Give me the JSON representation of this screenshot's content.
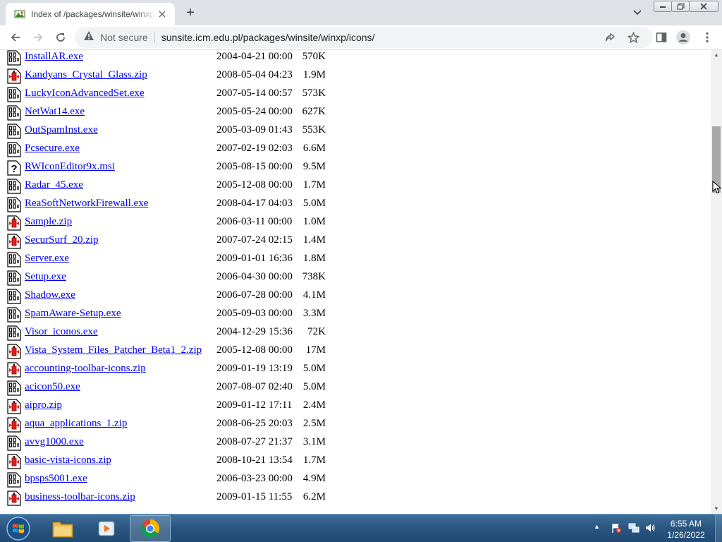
{
  "browser": {
    "tab_title": "Index of /packages/winsite/winxp/icons",
    "new_tab_label": "+",
    "security_label": "Not secure",
    "url": "sunsite.icm.edu.pl/packages/winsite/winxp/icons/"
  },
  "listing": [
    {
      "icon": "binary",
      "name": "InstallAR.exe",
      "date": "2004-04-21 00:00",
      "size": "570K"
    },
    {
      "icon": "archive",
      "name": "Kandyans_Crystal_Glass.zip",
      "date": "2008-05-04 04:23",
      "size": "1.9M"
    },
    {
      "icon": "binary",
      "name": "LuckyIconAdvancedSet.exe",
      "date": "2007-05-14 00:57",
      "size": "573K"
    },
    {
      "icon": "binary",
      "name": "NetWat14.exe",
      "date": "2005-05-24 00:00",
      "size": "627K"
    },
    {
      "icon": "binary",
      "name": "OutSpamInst.exe",
      "date": "2005-03-09 01:43",
      "size": "553K"
    },
    {
      "icon": "binary",
      "name": "Pcsecure.exe",
      "date": "2007-02-19 02:03",
      "size": "6.6M"
    },
    {
      "icon": "unknown",
      "name": "RWIconEditor9x.msi",
      "date": "2005-08-15 00:00",
      "size": "9.5M"
    },
    {
      "icon": "binary",
      "name": "Radar_45.exe",
      "date": "2005-12-08 00:00",
      "size": "1.7M"
    },
    {
      "icon": "binary",
      "name": "ReaSoftNetworkFirewall.exe",
      "date": "2008-04-17 04:03",
      "size": "5.0M"
    },
    {
      "icon": "archive",
      "name": "Sample.zip",
      "date": "2006-03-11 00:00",
      "size": "1.0M"
    },
    {
      "icon": "archive",
      "name": "SecurSurf_20.zip",
      "date": "2007-07-24 02:15",
      "size": "1.4M"
    },
    {
      "icon": "binary",
      "name": "Server.exe",
      "date": "2009-01-01 16:36",
      "size": "1.8M"
    },
    {
      "icon": "binary",
      "name": "Setup.exe",
      "date": "2006-04-30 00:00",
      "size": "738K"
    },
    {
      "icon": "binary",
      "name": "Shadow.exe",
      "date": "2006-07-28 00:00",
      "size": "4.1M"
    },
    {
      "icon": "binary",
      "name": "SpamAware-Setup.exe",
      "date": "2005-09-03 00:00",
      "size": "3.3M"
    },
    {
      "icon": "binary",
      "name": "Visor_iconos.exe",
      "date": "2004-12-29 15:36",
      "size": "72K"
    },
    {
      "icon": "archive",
      "name": "Vista_System_Files_Patcher_Beta1_2.zip",
      "date": "2005-12-08 00:00",
      "size": "17M"
    },
    {
      "icon": "archive",
      "name": "accounting-toolbar-icons.zip",
      "date": "2009-01-19 13:19",
      "size": "5.0M"
    },
    {
      "icon": "binary",
      "name": "acicon50.exe",
      "date": "2007-08-07 02:40",
      "size": "5.0M"
    },
    {
      "icon": "archive",
      "name": "aipro.zip",
      "date": "2009-01-12 17:11",
      "size": "2.4M"
    },
    {
      "icon": "archive",
      "name": "aqua_applications_1.zip",
      "date": "2008-06-25 20:03",
      "size": "2.5M"
    },
    {
      "icon": "binary",
      "name": "avvg1000.exe",
      "date": "2008-07-27 21:37",
      "size": "3.1M"
    },
    {
      "icon": "archive",
      "name": "basic-vista-icons.zip",
      "date": "2008-10-21 13:54",
      "size": "1.7M"
    },
    {
      "icon": "binary",
      "name": "bpsps5001.exe",
      "date": "2006-03-23 00:00",
      "size": "4.9M"
    },
    {
      "icon": "archive",
      "name": "business-toolbar-icons.zip",
      "date": "2009-01-15 11:55",
      "size": "6.2M"
    }
  ],
  "taskbar": {
    "clock_time": "6:55 AM",
    "clock_date": "1/26/2022",
    "tray_expand": "▲"
  },
  "colors": {
    "link": "#0000ee",
    "tab_strip": "#dee1e6",
    "taskbar": "#2a5580"
  },
  "icons": {
    "binary": "binary-file-icon",
    "archive": "compressed-file-icon",
    "unknown": "unknown-file-icon"
  }
}
